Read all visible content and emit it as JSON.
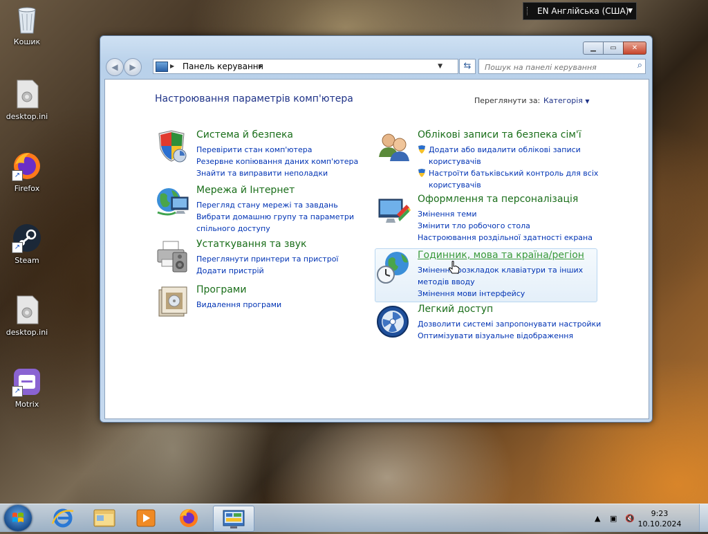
{
  "desktop": {
    "icons": [
      {
        "label": "Кошик",
        "icon": "recycle-bin-icon"
      },
      {
        "label": "desktop.ini",
        "icon": "settings-file-icon"
      },
      {
        "label": "Firefox",
        "icon": "firefox-icon"
      },
      {
        "label": "Steam",
        "icon": "steam-icon"
      },
      {
        "label": "desktop.ini",
        "icon": "settings-file-icon"
      },
      {
        "label": "Motrix",
        "icon": "motrix-icon"
      }
    ]
  },
  "language_bar": {
    "text": "EN Англійська (США)"
  },
  "window": {
    "address": {
      "crumb": "Панель керування"
    },
    "search": {
      "placeholder": "Пошук на панелі керування"
    },
    "page_title": "Настроювання параметрів комп'ютера",
    "view_by": {
      "label": "Переглянути за:",
      "value": "Категорія"
    },
    "categories_left": [
      {
        "title": "Система й безпека",
        "links": [
          "Перевірити стан комп'ютера",
          "Резервне копіювання даних комп'ютера",
          "Знайти та виправити неполадки"
        ]
      },
      {
        "title": "Мережа й Інтернет",
        "links": [
          "Перегляд стану мережі та завдань",
          "Вибрати домашню групу та параметри",
          "спільного доступу"
        ]
      },
      {
        "title": "Устаткування та звук",
        "links": [
          "Переглянути принтери та пристрої",
          "Додати пристрій"
        ]
      },
      {
        "title": "Програми",
        "links": [
          "Видалення програми"
        ]
      }
    ],
    "categories_right": [
      {
        "title": "Облікові записи та безпека сім'ї",
        "links": [
          "Додати або видалити облікові записи",
          "користувачів",
          "Настроїти батьківський контроль для всіх",
          "користувачів"
        ]
      },
      {
        "title": "Оформлення та персоналізація",
        "links": [
          "Змінення теми",
          "Змінити тло робочого стола",
          "Настроювання роздільної здатності екрана"
        ]
      },
      {
        "title": "Годинник, мова та країна/регіон",
        "links": [
          "Змінення розкладок клавіатури та інших",
          "методів вводу",
          "Змінення мови інтерфейсу"
        ]
      },
      {
        "title": "Легкий доступ",
        "links": [
          "Дозволити системі запропонувати настройки",
          "Оптимізувати візуальне відображення"
        ]
      }
    ]
  },
  "taskbar": {
    "clock": {
      "time": "9:23",
      "date": "10.10.2024"
    },
    "pinned": [
      "internet-explorer-icon",
      "file-explorer-icon",
      "media-player-icon",
      "firefox-icon",
      "control-panel-icon"
    ]
  },
  "colors": {
    "link": "#0033b4",
    "category_title": "#1a6e1a",
    "page_title": "#1e3287"
  }
}
